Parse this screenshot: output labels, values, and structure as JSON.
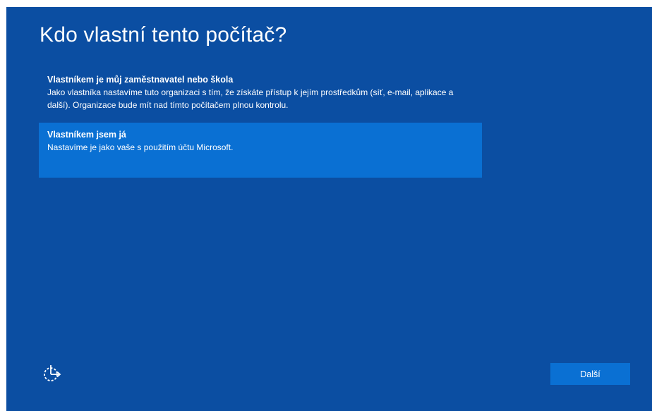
{
  "page": {
    "title": "Kdo vlastní tento počítač?"
  },
  "options": [
    {
      "title": "Vlastníkem je můj zaměstnavatel nebo škola",
      "description": "Jako vlastníka nastavíme tuto organizaci s tím, že získáte přístup k jejím prostředkům (síť, e-mail, aplikace a další). Organizace bude mít nad tímto počítačem plnou kontrolu.",
      "selected": false
    },
    {
      "title": "Vlastníkem jsem já",
      "description": "Nastavíme je jako vaše s použitím účtu Microsoft.",
      "selected": true
    }
  ],
  "footer": {
    "accessibility_icon": "ease-of-access-icon",
    "next_label": "Další"
  },
  "colors": {
    "background": "#0b4ea2",
    "selected": "#0a70d3",
    "button": "#0a70d3",
    "text": "#ffffff"
  }
}
